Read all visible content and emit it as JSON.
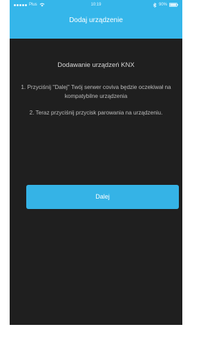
{
  "status_bar": {
    "carrier": "Plus",
    "time": "10:19",
    "battery": "90%",
    "icons": [
      "signal-icon",
      "wifi-icon",
      "bluetooth-icon",
      "battery-icon"
    ]
  },
  "header": {
    "title": "Dodaj urządzenie"
  },
  "main": {
    "heading": "Dodawanie urządzeń KNX",
    "step1": "1. Przyciśnij \"Dalej\" Twój serwer coviva będzie oczekiwał na kompatybilne urządzenia",
    "step2": "2. Teraz przyciśnij przycisk parowania na urządzeniu.",
    "next_label": "Dalej"
  },
  "colors": {
    "header_bg": "#35b6ea",
    "screen_bg": "#1f1f1f",
    "button_bg": "#35b3e6"
  }
}
